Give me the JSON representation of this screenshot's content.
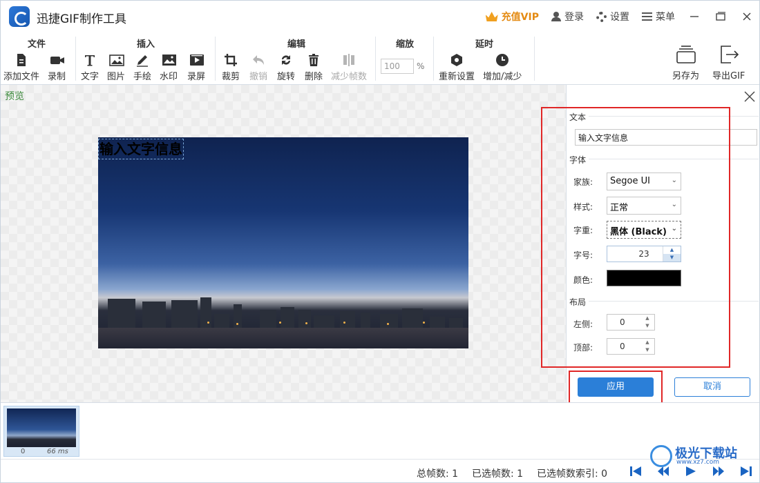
{
  "app": {
    "title": "迅捷GIF制作工具"
  },
  "titlebar": {
    "vip": "充值VIP",
    "login": "登录",
    "settings": "设置",
    "menu": "菜单"
  },
  "ribbon": {
    "file": {
      "title": "文件",
      "add_file": "添加文件",
      "record": "录制"
    },
    "insert": {
      "title": "插入",
      "text": "文字",
      "image": "图片",
      "draw": "手绘",
      "watermark": "水印",
      "screen_record": "录屏"
    },
    "edit": {
      "title": "编辑",
      "crop": "裁剪",
      "undo": "撤销",
      "rotate": "旋转",
      "delete": "删除",
      "reduce_frames": "减少帧数"
    },
    "zoom": {
      "title": "缩放",
      "value": "100",
      "unit": "%"
    },
    "delay": {
      "title": "延时",
      "reset": "重新设置",
      "increase_decrease": "增加/减少"
    },
    "save_as": "另存为",
    "export_gif": "导出GIF"
  },
  "preview": {
    "label": "预览",
    "overlay_text": "输入文字信息"
  },
  "panel": {
    "text_section": "文本",
    "text_value": "输入文字信息",
    "font_section": "字体",
    "family_label": "家族:",
    "family_value": "Segoe UI",
    "style_label": "样式:",
    "style_value": "正常",
    "weight_label": "字重:",
    "weight_value": "黑体 (Black)",
    "size_label": "字号:",
    "size_value": "23",
    "color_label": "颜色:",
    "color_value": "#000000",
    "layout_section": "布局",
    "left_label": "左侧:",
    "left_value": "0",
    "top_label": "顶部:",
    "top_value": "0",
    "apply": "应用",
    "cancel": "取消"
  },
  "filmstrip": {
    "frames": [
      {
        "index": "0",
        "duration": "66 ms"
      }
    ]
  },
  "status": {
    "total_frames": "总帧数: 1",
    "selected_frames": "已选帧数: 1",
    "selected_index": "已选帧数索引: 0"
  },
  "watermark": {
    "site": "极光下载站",
    "url": "www.xz7.com"
  },
  "colors": {
    "accent": "#2b7fd8",
    "highlight": "#e02626",
    "vip": "#e48a12",
    "preview_label": "#3c8a3c"
  }
}
